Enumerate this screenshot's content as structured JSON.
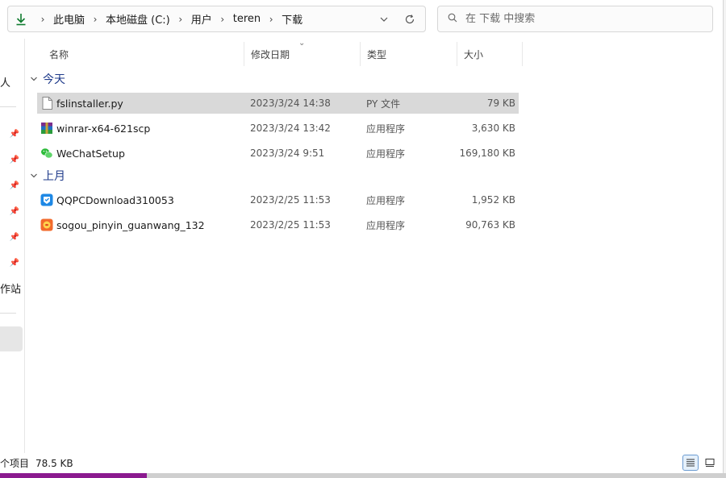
{
  "address_bar": {
    "icon": "download-arrow-icon",
    "breadcrumbs": [
      "此电脑",
      "本地磁盘 (C:)",
      "用户",
      "teren",
      "下载"
    ]
  },
  "search": {
    "placeholder": "在 下载 中搜索"
  },
  "sidebar": {
    "partial_labels": [
      "人",
      "作站"
    ]
  },
  "columns": {
    "name": "名称",
    "date": "修改日期",
    "type": "类型",
    "size": "大小"
  },
  "groups": [
    {
      "label": "今天",
      "files": [
        {
          "name": "fslinstaller.py",
          "date": "2023/3/24 14:38",
          "type": "PY 文件",
          "size": "79 KB",
          "icon": "document-icon",
          "selected": true
        },
        {
          "name": "winrar-x64-621scp",
          "date": "2023/3/24 13:42",
          "type": "应用程序",
          "size": "3,630 KB",
          "icon": "winrar-icon",
          "selected": false
        },
        {
          "name": "WeChatSetup",
          "date": "2023/3/24 9:51",
          "type": "应用程序",
          "size": "169,180 KB",
          "icon": "wechat-icon",
          "selected": false
        }
      ]
    },
    {
      "label": "上月",
      "files": [
        {
          "name": "QQPCDownload310053",
          "date": "2023/2/25 11:53",
          "type": "应用程序",
          "size": "1,952 KB",
          "icon": "qq-pc-manager-icon",
          "selected": false
        },
        {
          "name": "sogou_pinyin_guanwang_132",
          "date": "2023/2/25 11:53",
          "type": "应用程序",
          "size": "90,763 KB",
          "icon": "sogou-icon",
          "selected": false
        }
      ]
    }
  ],
  "status": {
    "items_label": "个项目",
    "selected_size": "78.5 KB"
  },
  "colors": {
    "accent": "#0f7b2e",
    "selection": "#d9d9d9",
    "group_header": "#1e3a8a",
    "taskbar_accent": "#8b1a8f"
  }
}
